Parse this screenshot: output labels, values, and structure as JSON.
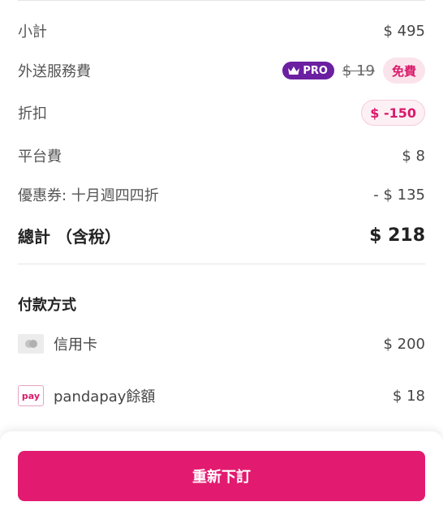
{
  "summary": {
    "subtotal": {
      "label": "小計",
      "amount": "$ 495"
    },
    "delivery": {
      "label": "外送服務費",
      "pro_badge": "PRO",
      "original": "$ 19",
      "free": "免費"
    },
    "discount": {
      "label": "折扣",
      "amount": "$ -150"
    },
    "platform_fee": {
      "label": "平台費",
      "amount": "$ 8"
    },
    "voucher": {
      "label": "優惠券: 十月週四四折",
      "amount": "- $ 135"
    },
    "total": {
      "label": "總計 （含稅）",
      "amount": "$ 218"
    }
  },
  "payment": {
    "title": "付款方式",
    "methods": [
      {
        "icon": "credit-card-icon",
        "label": "信用卡",
        "amount": "$ 200"
      },
      {
        "icon": "pandapay-icon",
        "icon_text": "pay",
        "label": "pandapay餘額",
        "amount": "$ 18"
      }
    ]
  },
  "actions": {
    "reorder_label": "重新下訂"
  },
  "colors": {
    "accent": "#e21b70",
    "pro": "#6b1fa1",
    "free_bg": "#fbe3ec"
  }
}
